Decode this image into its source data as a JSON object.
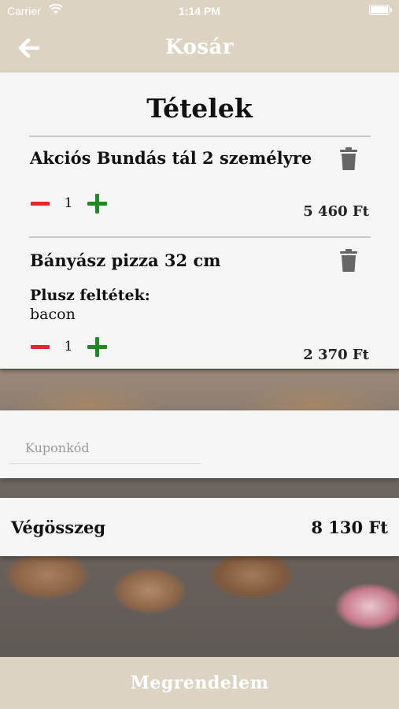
{
  "status_bar": {
    "carrier": "Carrier",
    "time": "1:14 PM"
  },
  "nav": {
    "title": "Kosár",
    "back_icon": "arrow-left-icon"
  },
  "cart": {
    "heading": "Tételek",
    "items": [
      {
        "name": "Akciós Bundás tál 2 személyre",
        "quantity": "1",
        "price": "5 460 Ft",
        "extras_label": "",
        "extras": ""
      },
      {
        "name": "Bányász pizza 32 cm",
        "quantity": "1",
        "price": "2 370 Ft",
        "extras_label": "Plusz feltétek:",
        "extras": "bacon"
      }
    ]
  },
  "coupon": {
    "placeholder": "Kuponkód",
    "value": ""
  },
  "total": {
    "label": "Végösszeg",
    "value": "8 130 Ft"
  },
  "order_button": {
    "label": "Megrendelem"
  },
  "colors": {
    "header_bg": "#ddd3c2",
    "card_bg": "#f5f5f5",
    "minus": "#e8262a",
    "plus": "#1f8a23",
    "trash": "#666666"
  }
}
